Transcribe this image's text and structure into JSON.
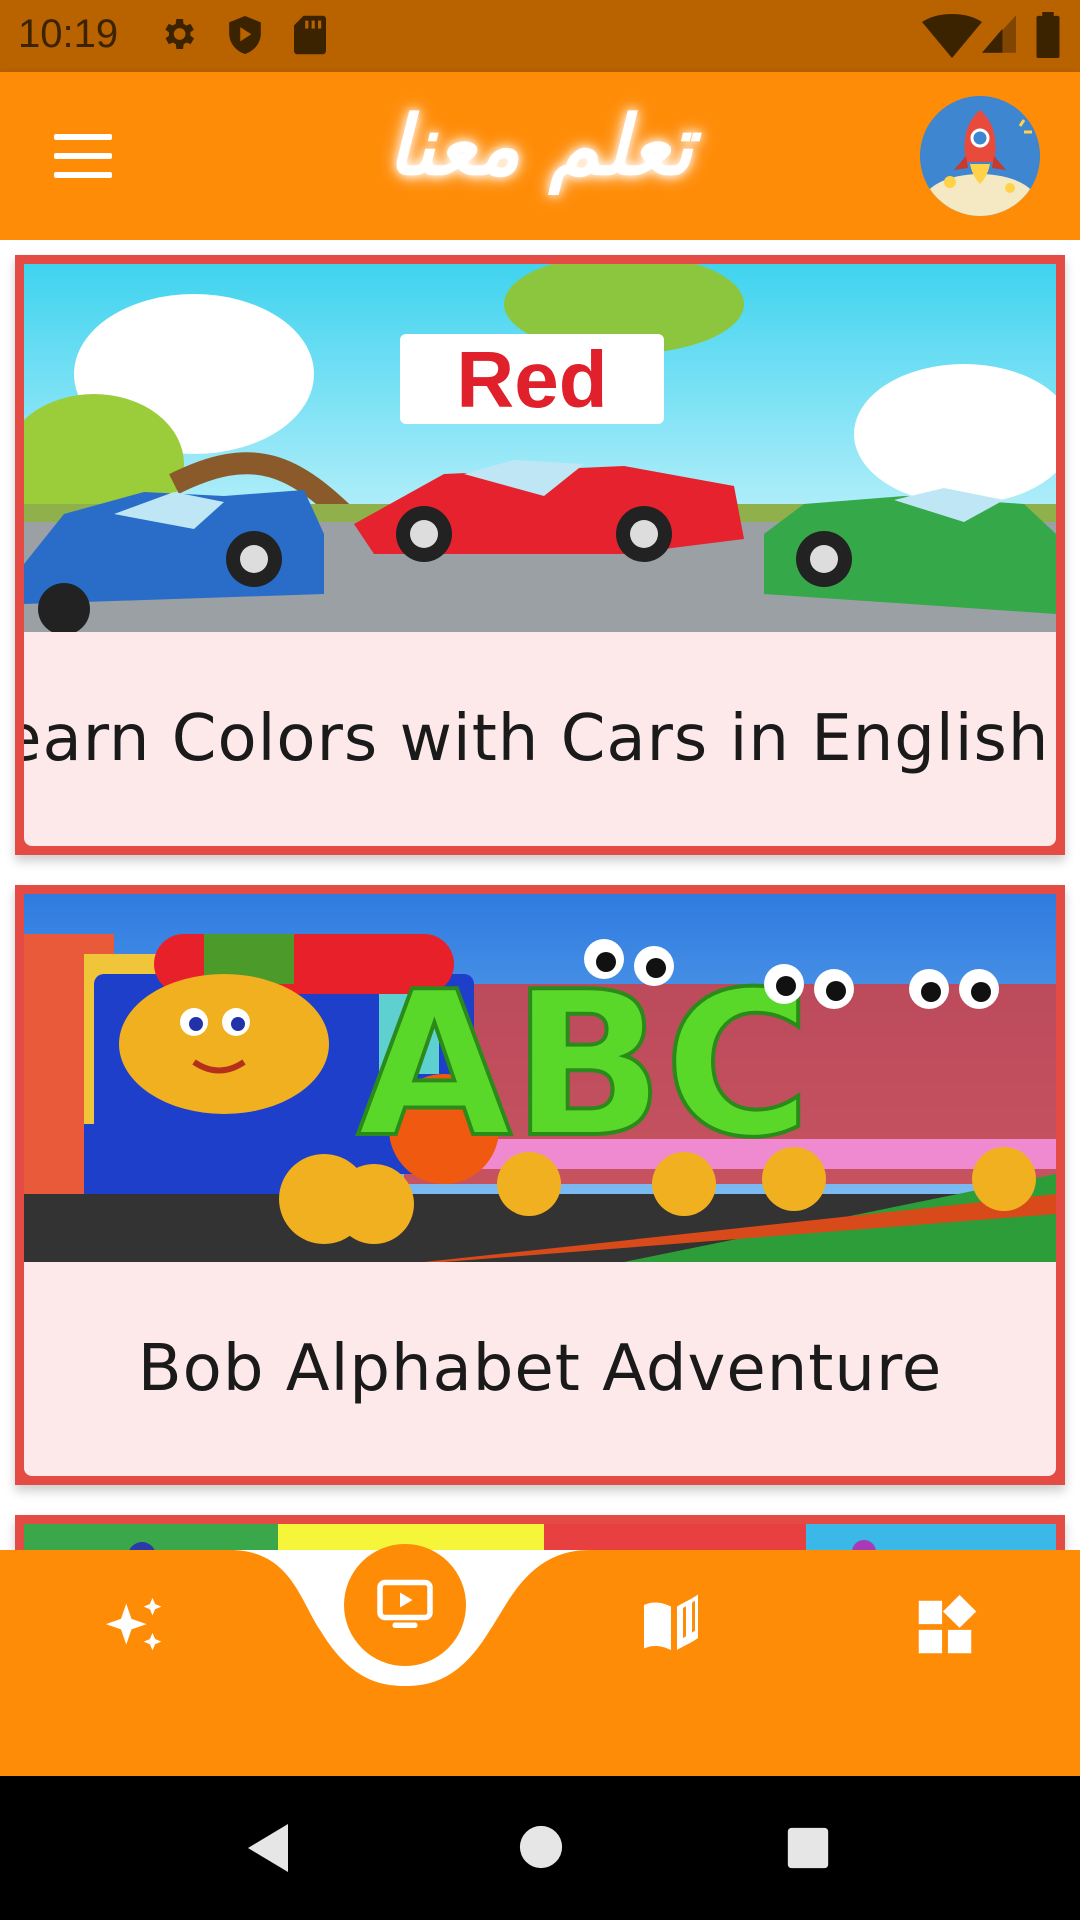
{
  "status_bar": {
    "time": "10:19"
  },
  "app_bar": {
    "title": "تعلم معنا"
  },
  "cards": [
    {
      "title": "Learn Colors with Cars in English...",
      "thumbnail_text": "Red"
    },
    {
      "title": "Bob Alphabet Adventure",
      "thumbnail_text": "ABC"
    }
  ],
  "colors": {
    "accent": "#ff8c07",
    "status_bar": "#b86200",
    "card_border": "#e34b44",
    "card_bg": "#fde8ea"
  },
  "bottom_nav": {
    "items": [
      {
        "icon": "sparkles-icon"
      },
      {
        "icon": "video-library-icon"
      },
      {
        "icon": "book-icon"
      },
      {
        "icon": "widgets-icon"
      }
    ]
  }
}
